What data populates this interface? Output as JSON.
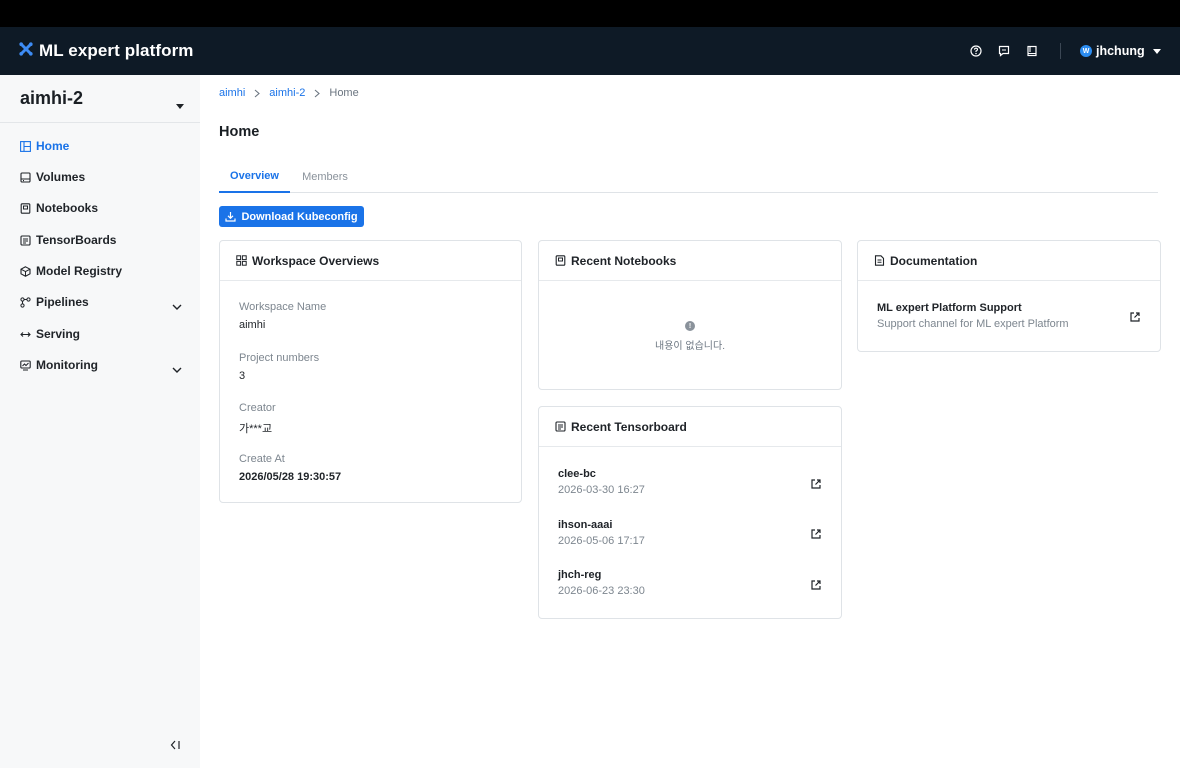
{
  "app": {
    "title": "ML expert platform"
  },
  "user": {
    "initial": "W",
    "name": "jhchung"
  },
  "header_icons": [
    "help-icon",
    "chat-icon",
    "book-icon"
  ],
  "workspace": {
    "selected": "aimhi-2"
  },
  "sidebar": {
    "items": [
      {
        "label": "Home",
        "icon": "layout-icon",
        "active": true
      },
      {
        "label": "Volumes",
        "icon": "disk-icon"
      },
      {
        "label": "Notebooks",
        "icon": "notebook-icon"
      },
      {
        "label": "TensorBoards",
        "icon": "board-icon"
      },
      {
        "label": "Model Registry",
        "icon": "registry-icon"
      },
      {
        "label": "Pipelines",
        "icon": "pipeline-icon",
        "expandable": true
      },
      {
        "label": "Serving",
        "icon": "serving-icon"
      },
      {
        "label": "Monitoring",
        "icon": "monitor-icon",
        "expandable": true
      }
    ]
  },
  "breadcrumb": [
    "aimhi",
    "aimhi-2",
    "Home"
  ],
  "page": {
    "title": "Home"
  },
  "tabs": [
    {
      "label": "Overview",
      "active": true
    },
    {
      "label": "Members",
      "active": false
    }
  ],
  "actions": {
    "download_label": "Download Kubeconfig"
  },
  "workspace_overview": {
    "title": "Workspace Overviews",
    "fields": [
      {
        "label": "Workspace Name",
        "value": "aimhi"
      },
      {
        "label": "Project numbers",
        "value": "3"
      },
      {
        "label": "Creator",
        "value": "가***교"
      },
      {
        "label": "Create At",
        "value": "2026/05/28 19:30:57"
      }
    ]
  },
  "recent_notebooks": {
    "title": "Recent Notebooks",
    "empty_text": "내용이 없습니다."
  },
  "recent_tensorboard": {
    "title": "Recent Tensorboard",
    "items": [
      {
        "name": "clee-bc",
        "date": "2026-03-30 16:27"
      },
      {
        "name": "ihson-aaai",
        "date": "2026-05-06 17:17"
      },
      {
        "name": "jhch-reg",
        "date": "2026-06-23 23:30"
      }
    ]
  },
  "documentation": {
    "title": "Documentation",
    "items": [
      {
        "title": "ML expert Platform Support",
        "description": "Support channel for ML expert Platform"
      }
    ]
  },
  "colors": {
    "header_bg": "#0e1a26",
    "accent": "#1a73e8",
    "sidebar_bg": "#f7f8f9"
  }
}
